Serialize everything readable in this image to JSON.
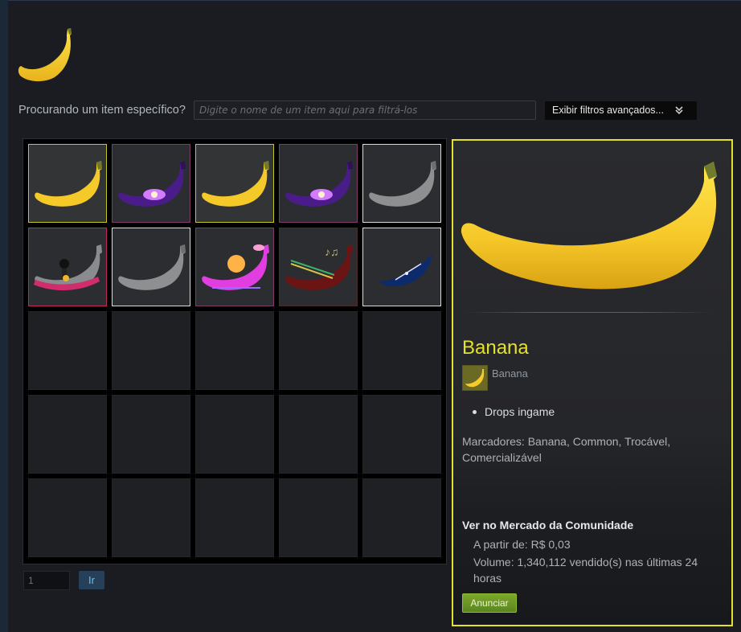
{
  "search": {
    "label": "Procurando um item específico?",
    "placeholder": "Digite o nome de um item aqui para filtrá-los",
    "filters_button": "Exibir filtros avançados..."
  },
  "inventory": {
    "items": [
      {
        "kind": "banana-yellow",
        "quality": "yellow"
      },
      {
        "kind": "banana-galaxy",
        "quality": "purple"
      },
      {
        "kind": "banana-yellow",
        "quality": "yellow"
      },
      {
        "kind": "banana-galaxy",
        "quality": "purple"
      },
      {
        "kind": "banana-grey",
        "quality": "white"
      },
      {
        "kind": "banana-llama",
        "quality": "pink"
      },
      {
        "kind": "banana-grey",
        "quality": "white"
      },
      {
        "kind": "banana-synthwave",
        "quality": "purple"
      },
      {
        "kind": "banana-music",
        "quality": "dark"
      },
      {
        "kind": "banana-space",
        "quality": "white"
      }
    ],
    "total_slots": 25
  },
  "pagination": {
    "page_value": "1",
    "go_label": "Ir"
  },
  "detail": {
    "name": "Banana",
    "game_name": "Banana",
    "descriptions": [
      "Drops ingame"
    ],
    "tags": "Marcadores: Banana, Common, Trocável, Comercializável",
    "market": {
      "title": "Ver no Mercado da Comunidade",
      "price": "A partir de: R$ 0,03",
      "volume": "Volume: 1,340,112 vendido(s) nas últimas 24 horas",
      "sell_button": "Anunciar"
    }
  },
  "colors": {
    "highlight": "#e4e02e",
    "background": "#1b1c21",
    "accent_blue": "#66c0f4",
    "sell_green": "#6d9a25"
  }
}
